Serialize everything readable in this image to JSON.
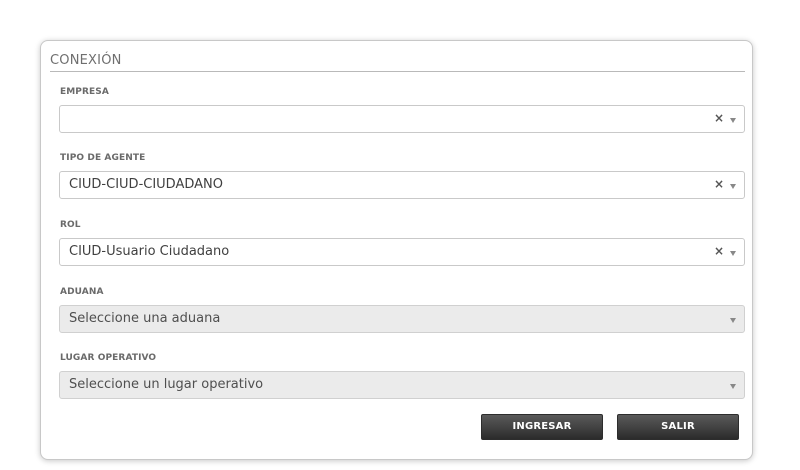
{
  "panel": {
    "title": "CONEXIÓN"
  },
  "fields": [
    {
      "label": "EMPRESA",
      "value": "",
      "clear_icon": "×",
      "disabled": false
    },
    {
      "label": "TIPO DE AGENTE",
      "value": "CIUD-CIUD-CIUDADANO",
      "clear_icon": "×",
      "disabled": false
    },
    {
      "label": "ROL",
      "value": "CIUD-Usuario Ciudadano",
      "clear_icon": "×",
      "disabled": false
    },
    {
      "label": "ADUANA",
      "value": "Seleccione una aduana",
      "disabled": true
    },
    {
      "label": "LUGAR OPERATIVO",
      "value": "Seleccione un lugar operativo",
      "disabled": true
    }
  ],
  "buttons": {
    "login_label": "INGRESAR",
    "exit_label": "SALIR"
  },
  "icons": {
    "clear": "clear-x-icon",
    "dropdown": "chevron-down-icon"
  },
  "colors": {
    "button_bg": "#3a3a3a",
    "disabled_field_bg": "#ebebeb",
    "border": "#c9c9c9"
  }
}
